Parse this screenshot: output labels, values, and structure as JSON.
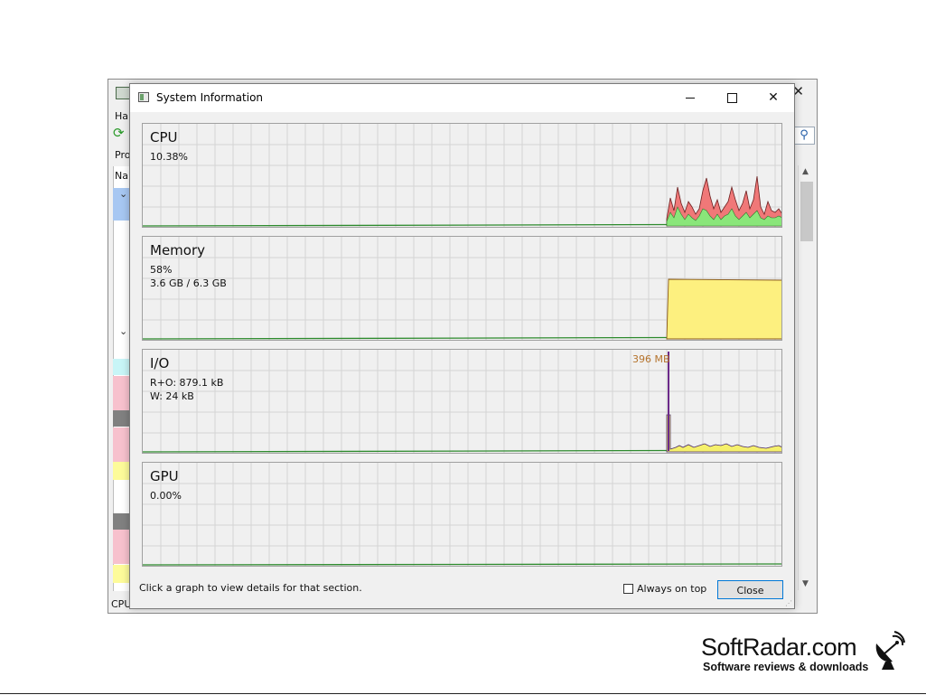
{
  "background_window": {
    "close_glyph": "✕",
    "menu_fragment": "Ha",
    "tab_fragment": "Pro",
    "column_fragment": "Na",
    "status_fragment": "CPU",
    "row_colors": [
      "#a7c7f2",
      "#c8f5f7",
      "#f7c1cd",
      "#808080",
      "#f7c1cd",
      "#fdfb9a",
      "#808080",
      "#f7c1cd",
      "#fdfb9a"
    ]
  },
  "dialog": {
    "title": "System Information",
    "min_icon": "minimize-icon",
    "max_icon": "maximize-icon",
    "close_glyph": "✕"
  },
  "panels": {
    "cpu": {
      "title": "CPU",
      "line1": "10.38%"
    },
    "memory": {
      "title": "Memory",
      "line1": "58%",
      "line2": "3.6 GB / 6.3 GB"
    },
    "io": {
      "title": "I/O",
      "line1": "R+O: 879.1 kB",
      "line2": "W: 24 kB",
      "peak_label": "396 MB"
    },
    "gpu": {
      "title": "GPU",
      "line1": "0.00%"
    }
  },
  "footer": {
    "hint": "Click a graph to view details for that section.",
    "always_on_top_label": "Always on top",
    "always_on_top_checked": false,
    "close_label": "Close"
  },
  "colors": {
    "cpu_total": "#f07878",
    "cpu_kernel": "#8ae67a",
    "memory_fill": "#fdf07f",
    "io_other": "#f5f06b",
    "io_read_write": "#6c2a8a",
    "baseline": "#2d8a2d"
  },
  "watermark": {
    "brand": "SoftRadar.com",
    "tagline": "Software reviews & downloads"
  }
}
